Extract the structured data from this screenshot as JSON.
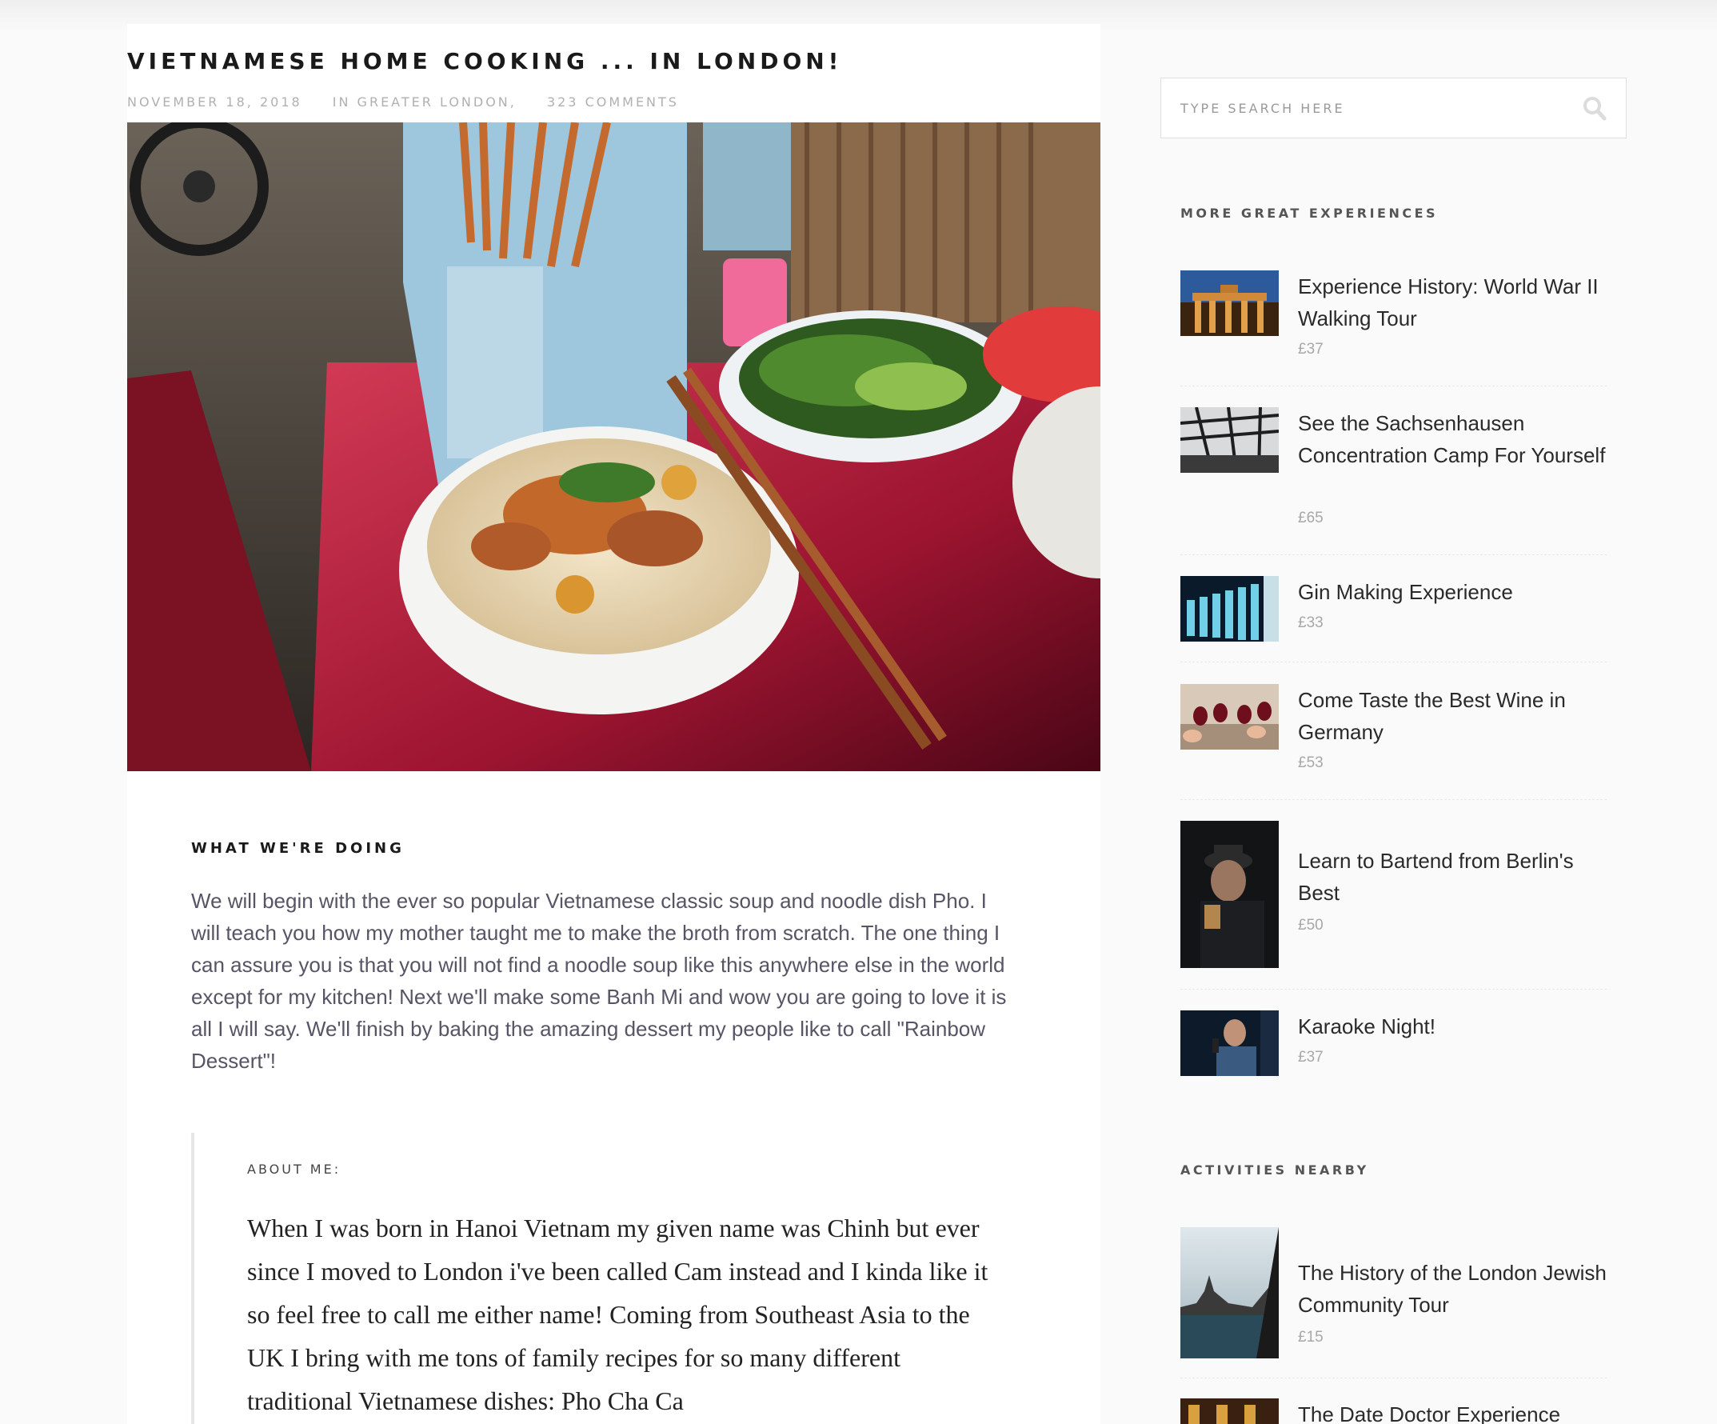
{
  "post": {
    "title": "VIETNAMESE HOME COOKING ... IN LONDON!",
    "date": "NOVEMBER 18, 2018",
    "category": "IN GREATER LONDON,",
    "comments": "323 COMMENTS"
  },
  "section": {
    "heading": "WHAT WE'RE DOING",
    "body": "We will begin with the ever so popular Vietnamese classic soup and noodle dish Pho. I will teach you how my mother taught me to make the broth from scratch. The one thing I can assure you is that you will not find a noodle soup like this anywhere else in the world except for my kitchen! Next we'll make some Banh Mi and wow you are going to love it is all I will say. We'll finish by baking the amazing dessert my people like to call \"Rainbow Dessert\"!"
  },
  "about": {
    "label": "ABOUT ME:",
    "text": "When I was born in Hanoi Vietnam my given name was Chinh but ever since I moved to London i've been called Cam instead and I kinda like it so feel free to call me either name! Coming from Southeast Asia to the UK I bring with me tons of family recipes for so many different traditional Vietnamese dishes: Pho Cha Ca"
  },
  "search": {
    "placeholder": "TYPE SEARCH HERE"
  },
  "sidebar": {
    "more_title": "MORE GREAT EXPERIENCES",
    "more_items": [
      {
        "title": "Experience History: World War II Walking Tour",
        "price": "£37"
      },
      {
        "title": "See the Sachsenhausen Concentration Camp For Yourself",
        "price": "£65"
      },
      {
        "title": "Gin Making Experience",
        "price": "£33"
      },
      {
        "title": "Come Taste the Best Wine in Germany",
        "price": "£53"
      },
      {
        "title": "Learn to Bartend from Berlin's Best",
        "price": "£50"
      },
      {
        "title": "Karaoke Night!",
        "price": "£37"
      }
    ],
    "nearby_title": "ACTIVITIES NEARBY",
    "nearby_items": [
      {
        "title": "The History of the London Jewish Community Tour",
        "price": "£15"
      },
      {
        "title": "The Date Doctor Experience",
        "price": ""
      }
    ]
  },
  "colors": {
    "accent_red": "#b3122a",
    "text_dark": "#1a1a1a",
    "meta_gray": "#b0b0b0"
  }
}
